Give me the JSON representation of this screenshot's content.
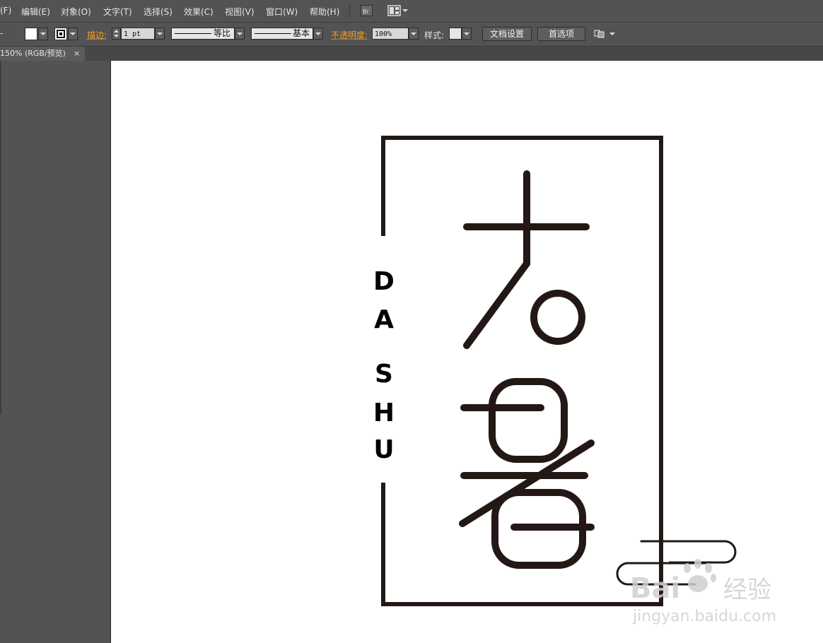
{
  "menubar": {
    "items": [
      {
        "label": "(F)"
      },
      {
        "label": "编辑(E)"
      },
      {
        "label": "对象(O)"
      },
      {
        "label": "文字(T)"
      },
      {
        "label": "选择(S)"
      },
      {
        "label": "效果(C)"
      },
      {
        "label": "视图(V)"
      },
      {
        "label": "窗口(W)"
      },
      {
        "label": "帮助(H)"
      }
    ],
    "bridge_label": "Br"
  },
  "control_bar": {
    "stroke_label": "描边:",
    "stroke_weight": "1 pt",
    "profile_label": "等比",
    "brush_label": "基本",
    "opacity_label": "不透明度:",
    "opacity_value": "100%",
    "style_label": "样式:",
    "doc_setup_button": "文档设置",
    "preferences_button": "首选项"
  },
  "document_tab": {
    "title": "150% (RGB/预览)",
    "close": "×"
  },
  "artwork": {
    "vertical_letters": [
      "D",
      "A",
      "S",
      "H",
      "U"
    ],
    "stroke_color": "#231815"
  },
  "watermark": {
    "brand": "Bai",
    "brand_suffix": "经验",
    "url": "jingyan.baidu.com"
  },
  "colors": {
    "ui_background": "#535353",
    "accent_orange": "#f0a030",
    "canvas": "#ffffff"
  }
}
